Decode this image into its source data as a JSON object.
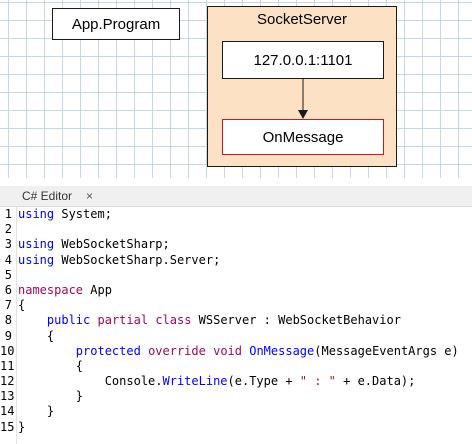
{
  "diagram": {
    "app_program": "App.Program",
    "socket_server": {
      "title": "SocketServer",
      "endpoint": "127.0.0.1:1101",
      "handler": "OnMessage"
    }
  },
  "editor": {
    "tab_label": "C# Editor",
    "tab_close": "×",
    "line_numbers": [
      "1",
      "2",
      "3",
      "4",
      "5",
      "6",
      "7",
      "8",
      "9",
      "10",
      "11",
      "12",
      "13",
      "14",
      "15"
    ],
    "lines": [
      [
        {
          "t": "using",
          "c": "kw"
        },
        {
          "t": " System;",
          "c": "plain"
        }
      ],
      [],
      [
        {
          "t": "using",
          "c": "kw"
        },
        {
          "t": " WebSocketSharp;",
          "c": "plain"
        }
      ],
      [
        {
          "t": "using",
          "c": "kw"
        },
        {
          "t": " WebSocketSharp.Server;",
          "c": "plain"
        }
      ],
      [],
      [
        {
          "t": "namespace",
          "c": "kw2"
        },
        {
          "t": " App",
          "c": "plain"
        }
      ],
      [
        {
          "t": "{",
          "c": "plain"
        }
      ],
      [
        {
          "t": "    ",
          "c": "plain"
        },
        {
          "t": "public",
          "c": "kw"
        },
        {
          "t": " ",
          "c": "plain"
        },
        {
          "t": "partial",
          "c": "kw2"
        },
        {
          "t": " ",
          "c": "plain"
        },
        {
          "t": "class",
          "c": "kw2"
        },
        {
          "t": " WSServer : WebSocketBehavior",
          "c": "plain"
        }
      ],
      [
        {
          "t": "    {",
          "c": "plain"
        }
      ],
      [
        {
          "t": "        ",
          "c": "plain"
        },
        {
          "t": "protected",
          "c": "kw"
        },
        {
          "t": " ",
          "c": "plain"
        },
        {
          "t": "override",
          "c": "kw2"
        },
        {
          "t": " ",
          "c": "plain"
        },
        {
          "t": "void",
          "c": "kw2"
        },
        {
          "t": " ",
          "c": "plain"
        },
        {
          "t": "OnMessage",
          "c": "meth"
        },
        {
          "t": "(MessageEventArgs e)",
          "c": "plain"
        }
      ],
      [
        {
          "t": "        {",
          "c": "plain"
        }
      ],
      [
        {
          "t": "            Console.",
          "c": "plain"
        },
        {
          "t": "WriteLine",
          "c": "meth"
        },
        {
          "t": "(e.Type + ",
          "c": "plain"
        },
        {
          "t": "\" : \"",
          "c": "str"
        },
        {
          "t": " + e.Data);",
          "c": "plain"
        }
      ],
      [
        {
          "t": "        }",
          "c": "plain"
        }
      ],
      [
        {
          "t": "    }",
          "c": "plain"
        }
      ],
      [
        {
          "t": "}",
          "c": "plain"
        }
      ]
    ]
  }
}
